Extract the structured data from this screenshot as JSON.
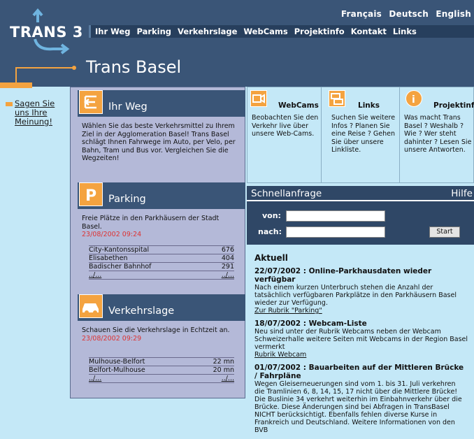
{
  "header": {
    "languages": [
      "Français",
      "Deutsch",
      "English"
    ],
    "logo_text": "TRANS 3",
    "nav": [
      "Ihr Weg",
      "Parking",
      "Verkehrslage",
      "WebCams",
      "Projektinfo",
      "Kontakt",
      "Links"
    ],
    "page_title": "Trans Basel"
  },
  "sidebar": {
    "feedback_link": "Sagen Sie uns Ihre Meinung!"
  },
  "left": {
    "ihr_weg": {
      "title": "Ihr Weg",
      "text": "Wählen Sie das beste Verkehrsmittel zu Ihrem Ziel in der Agglomeration Basel! Trans Basel schlägt Ihnen Fahrwege im Auto, per Velo, per Bahn, Tram und Bus vor. Vergleichen Sie die Wegzeiten!"
    },
    "parking": {
      "title": "Parking",
      "text": "Freie Plätze in den Parkhäusern der Stadt Basel.",
      "timestamp": "23/08/2002 09:24",
      "rows": [
        {
          "name": "City-Kantonsspital",
          "value": "676"
        },
        {
          "name": "Elisabethen",
          "value": "404"
        },
        {
          "name": "Badischer Bahnhof",
          "value": "291"
        },
        {
          "name": "../...",
          "value": "../..."
        }
      ]
    },
    "verkehrslage": {
      "title": "Verkehrslage",
      "text": "Schauen Sie die Verkehrslage in Echtzeit an.",
      "timestamp": "23/08/2002 09:29",
      "rows": [
        {
          "name": "Mulhouse-Belfort",
          "value": "22 mn"
        },
        {
          "name": "Belfort-Mulhouse",
          "value": "20 mn"
        },
        {
          "name": "../...",
          "value": "../..."
        }
      ]
    }
  },
  "topboxes": {
    "webcams": {
      "title": "WebCams",
      "text": "Beobachten Sie den Verkehr live über unsere Web-Cams."
    },
    "links": {
      "title": "Links",
      "text": "Suchen Sie weitere Infos ? Planen Sie eine Reise ? Gehen Sie über unsere Linkliste."
    },
    "projektinfo": {
      "title": "Projektinfo",
      "text": "Was macht Trans Basel ? Weshalb ? Wie ? Wer steht dahinter ? Lesen Sie unsere Antworten."
    }
  },
  "schnell": {
    "title": "Schnellanfrage",
    "help": "Hilfe",
    "von_label": "von:",
    "nach_label": "nach:",
    "von_value": "",
    "nach_value": "",
    "start": "Start"
  },
  "news": {
    "heading": "Aktuell",
    "items": [
      {
        "title": "22/07/2002 : Online-Parkhausdaten wieder verfügbar",
        "body": "Nach einem kurzen Unterbruch stehen die Anzahl der tatsächlich verfügbaren Parkplätze in den Parkhäusern Basel wieder zur Verfügung.",
        "link": "Zur Rubrik \"Parking\""
      },
      {
        "title": "18/07/2002 : Webcam-Liste",
        "body": "Neu sind unter der Rubrik Webcams neben der Webcam Schweizerhalle weitere Seiten mit Webcams in der Region Basel vermerkt",
        "link": "Rubrik Webcam"
      },
      {
        "title": "01/07/2002 : Bauarbeiten auf der Mittleren Brücke / Fahrpläne",
        "body": "Wegen Gleiserneuerungen sind vom 1. bis 31. Juli verkehren die Tramlinien 6, 8, 14, 15, 17 nicht über die Mittlere Brücke! Die Buslinie 34 verkehrt weiterhin im Einbahnverkehr über die Brücke. Diese Änderungen sind bei Abfragen in TransBasel NICHT berücksichtigt. Ebenfalls fehlen diverse Kurse in Frankreich und Deutschland. Weitere Informationen von den BVB",
        "link": ""
      }
    ]
  },
  "colors": {
    "navy": "#3a5577",
    "orange": "#f4a340",
    "light_blue": "#c4e8f7",
    "lilac": "#b4b9d8"
  }
}
